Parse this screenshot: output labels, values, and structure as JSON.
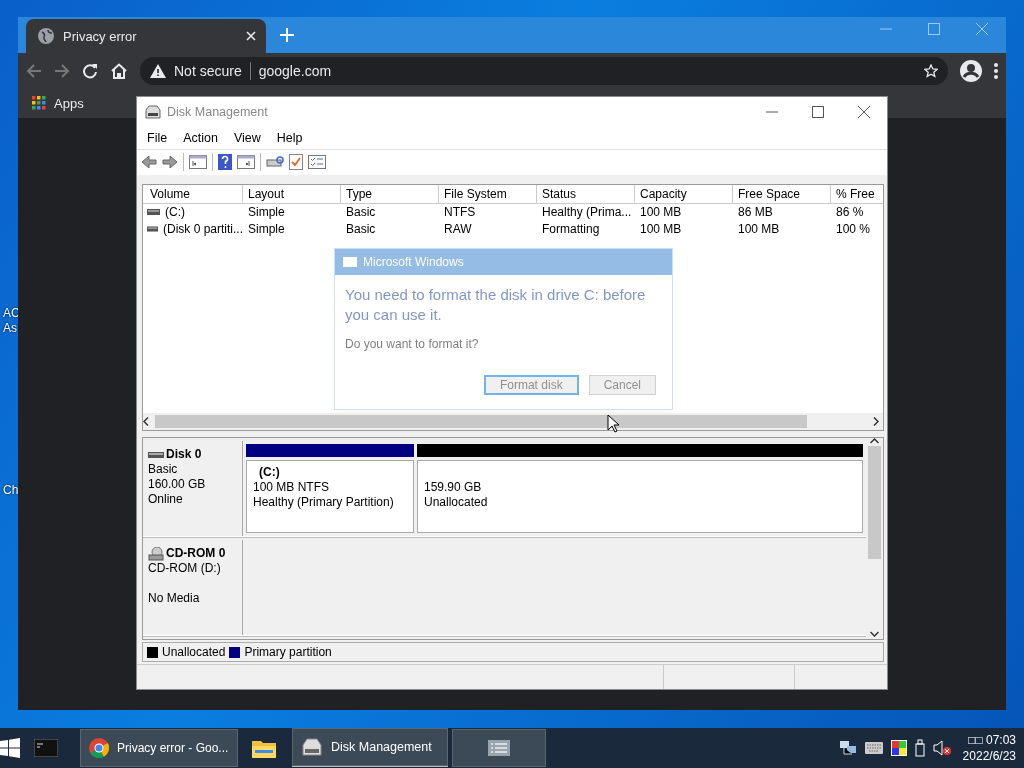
{
  "desktop_labels": [
    {
      "label": "AC"
    },
    {
      "label": "As"
    },
    {
      "label": "Ch"
    }
  ],
  "browser": {
    "tab": {
      "title": "Privacy error"
    },
    "security": "Not secure",
    "url": "google.com",
    "bookmarks": [
      {
        "label": "Apps"
      }
    ]
  },
  "disk_management": {
    "title": "Disk Management",
    "menu": [
      "File",
      "Action",
      "View",
      "Help"
    ],
    "volumes": {
      "columns": [
        "Volume",
        "Layout",
        "Type",
        "File System",
        "Status",
        "Capacity",
        "Free Space",
        "% Free"
      ],
      "rows": [
        [
          "(C:)",
          "Simple",
          "Basic",
          "NTFS",
          "Healthy (Prima...",
          "100 MB",
          "86 MB",
          "86 %"
        ],
        [
          "(Disk 0 partiti...",
          "Simple",
          "Basic",
          "RAW",
          "Formatting",
          "100 MB",
          "100 MB",
          "100 %"
        ]
      ]
    },
    "disks": [
      {
        "kind": "disk",
        "name": "Disk 0",
        "type": "Basic",
        "size": "160.00 GB",
        "status": "Online",
        "partitions": [
          {
            "kind": "primary",
            "color": "#000080",
            "label": "(C:)",
            "lines": [
              "100 MB NTFS",
              "Healthy (Primary Partition)"
            ]
          },
          {
            "kind": "unallocated",
            "color": "#000000",
            "lines": [
              "159.90 GB",
              "Unallocated"
            ]
          }
        ]
      },
      {
        "kind": "cdrom",
        "name": "CD-ROM 0",
        "type": "CD-ROM (D:)",
        "status": "No Media"
      }
    ],
    "legend": [
      {
        "label": "Unallocated",
        "color": "#000000"
      },
      {
        "label": "Primary partition",
        "color": "#000080"
      }
    ],
    "dialog": {
      "title": "Microsoft Windows",
      "message": "You need to format the disk in drive C: before you can use it.",
      "question": "Do you want to format it?",
      "buttons": [
        {
          "label": "Format disk",
          "selected": true
        },
        {
          "label": "Cancel",
          "selected": false
        }
      ]
    }
  },
  "taskbar": {
    "items": [
      {
        "kind": "terminal",
        "open": false
      },
      {
        "kind": "chrome",
        "label": "Privacy error - Goo...",
        "open": true
      },
      {
        "kind": "explorer",
        "open": false
      },
      {
        "kind": "disk",
        "label": "Disk Management",
        "open": true
      },
      {
        "kind": "list",
        "open": true
      }
    ],
    "time": "□□ 07:03",
    "date": "2022/6/23"
  }
}
